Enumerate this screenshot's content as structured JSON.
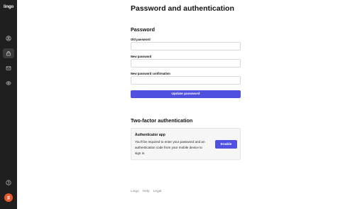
{
  "sidebar": {
    "logo": "lingo",
    "items": [
      {
        "icon": "user-circle-icon"
      },
      {
        "icon": "lock-icon",
        "active": true
      },
      {
        "icon": "mail-icon"
      },
      {
        "icon": "eye-icon"
      }
    ],
    "help_icon": "help-circle-icon",
    "avatar_icon": "avatar-logo-icon",
    "accent": "#e8572a"
  },
  "main": {
    "title": "Password and authentication",
    "password": {
      "heading": "Password",
      "old_label": "Old password",
      "new_label": "New password",
      "confirm_label": "New password confirmation",
      "old_value": "",
      "new_value": "",
      "confirm_value": "",
      "submit_label": "Update password"
    },
    "two_factor": {
      "heading": "Two-factor authentication",
      "card_title": "Authenticator app",
      "card_description": "You'll be required to enter your password and an authentication code from your mobile device to sign in.",
      "enable_label": "Enable"
    },
    "footer": {
      "links": [
        "Lingo",
        "Help",
        "Legal"
      ]
    }
  },
  "colors": {
    "primary": "#4f4fe0",
    "sidebar_bg": "#1f1f1f"
  }
}
